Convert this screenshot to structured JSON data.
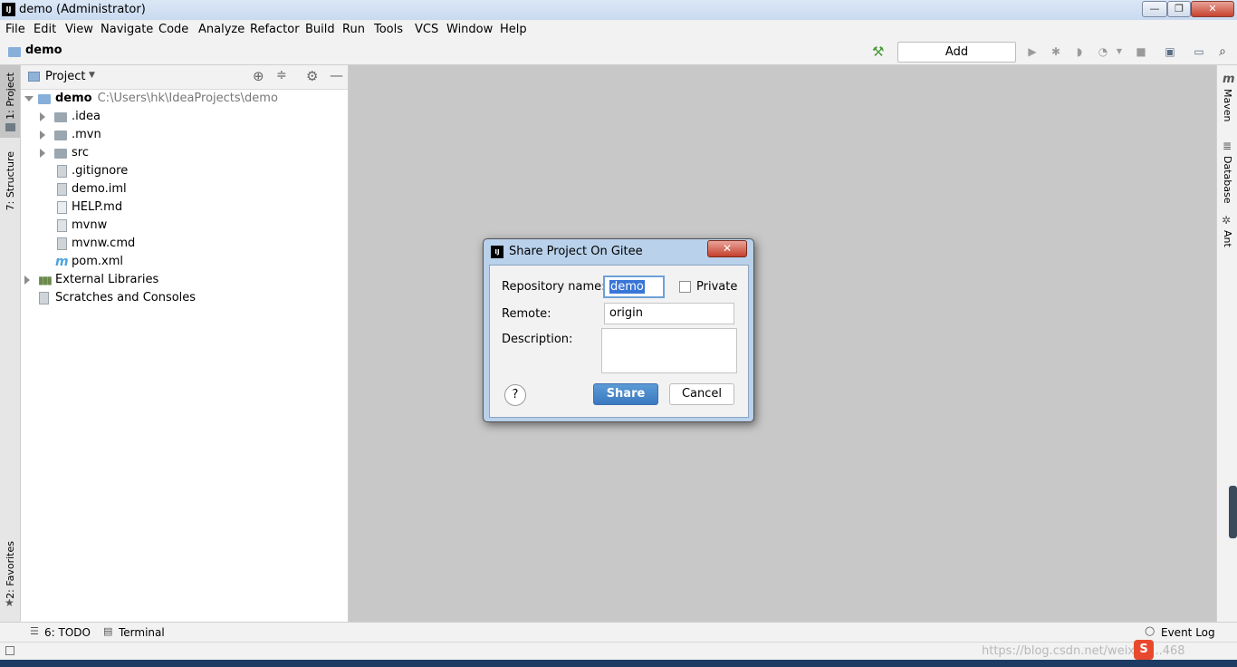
{
  "window": {
    "title": "demo (Administrator)",
    "app_icon": "IJ",
    "controls": {
      "minimize": "—",
      "restore": "❐",
      "close": "✕"
    }
  },
  "menu": [
    "File",
    "Edit",
    "View",
    "Navigate",
    "Code",
    "Analyze",
    "Refactor",
    "Build",
    "Run",
    "Tools",
    "VCS",
    "Window",
    "Help"
  ],
  "navbar": {
    "breadcrumb": "demo",
    "add_configuration": "Add Configuration..."
  },
  "left_stripe": {
    "project_tab": "1: Project",
    "structure_tab": "7: Structure",
    "favorites_tab": "2: Favorites"
  },
  "right_stripe": {
    "maven": "Maven",
    "database": "Database",
    "ant": "Ant"
  },
  "project_panel": {
    "view_label": "Project",
    "tree": {
      "root": {
        "name": "demo",
        "path": "C:\\Users\\hk\\IdeaProjects\\demo"
      },
      "items": [
        ".idea",
        ".mvn",
        "src",
        ".gitignore",
        "demo.iml",
        "HELP.md",
        "mvnw",
        "mvnw.cmd",
        "pom.xml"
      ],
      "external_libraries": "External Libraries",
      "scratches": "Scratches and Consoles"
    }
  },
  "bottom_tabs": {
    "todo": "6: TODO",
    "terminal": "Terminal",
    "event_log": "Event Log"
  },
  "dialog": {
    "title": "Share Project On Gitee",
    "close": "✕",
    "repository_name_label": "Repository name:",
    "repository_name_value": "demo",
    "private_label": "Private",
    "remote_label": "Remote:",
    "remote_value": "origin",
    "description_label": "Description:",
    "description_value": "",
    "help": "?",
    "share": "Share",
    "cancel": "Cancel"
  },
  "watermark": "https://blog.csdn.net/weixin_...468"
}
